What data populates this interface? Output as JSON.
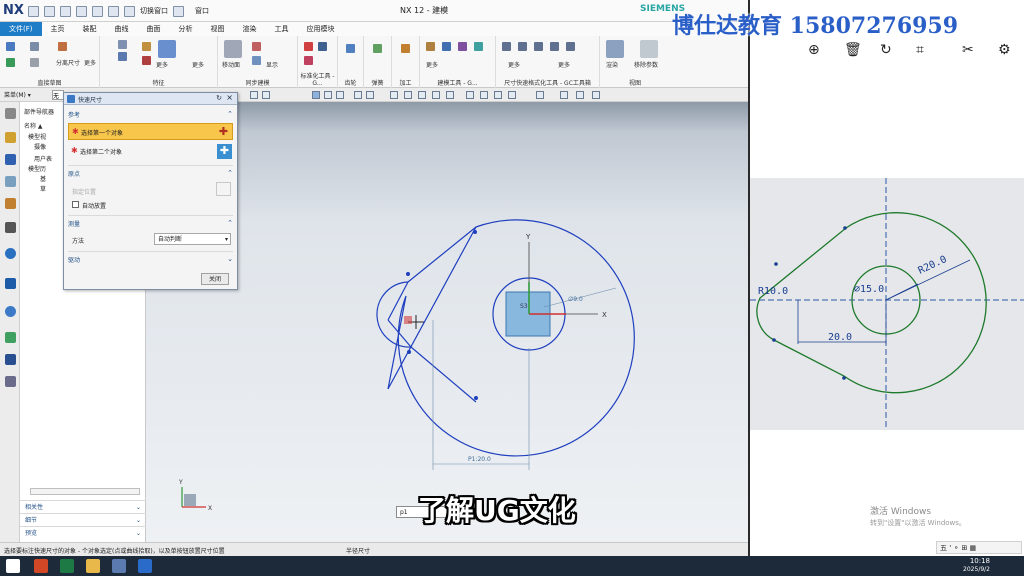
{
  "window": {
    "app_logo": "NX",
    "title": "NX 12 - 建模",
    "brand": "SIEMENS"
  },
  "quick_access": {
    "window_label": "窗口",
    "cut_label": "切换窗口"
  },
  "menu": {
    "items": [
      "文件(F)",
      "主页",
      "装配",
      "曲线",
      "曲面",
      "分析",
      "视图",
      "渲染",
      "工具",
      "应用模块"
    ]
  },
  "ribbon": {
    "groups": [
      "直接草图",
      "特征",
      "同步建模",
      "标准化工具 - G...",
      "齿轮",
      "弹簧",
      "加工",
      "建模工具 - G...",
      "尺寸快速格式化工具 - GC工具箱",
      "视图"
    ],
    "labels": [
      "分离尺寸",
      "更多",
      "更多",
      "更多",
      "移动面",
      "显示",
      "更多",
      "更多",
      "更多",
      "渲染",
      "移除参数",
      "更多",
      "更多",
      "更多",
      "更多",
      "更多",
      "更多"
    ]
  },
  "toolbar2": {
    "menu_label": "菜单(M) ▾",
    "filter_label": "无"
  },
  "nav": {
    "title": "部件导航器",
    "col_header": "名称 ▲",
    "tree": [
      "模型视",
      "摄像",
      "用户表",
      "模型历",
      "基",
      "草"
    ],
    "sections": [
      "相关性",
      "细节",
      "预览"
    ]
  },
  "dialog": {
    "title": "快速尺寸",
    "sec_ref": "参考",
    "sel_first": "选择第一个对象",
    "sel_second": "选择第二个对象",
    "sec_origin": "原点",
    "origin_loc": "指定位置",
    "auto_place": "自动放置",
    "sec_measure": "测量",
    "method_label": "方法",
    "method_value": "自动判断",
    "sec_driving": "驱动",
    "close_label": "关闭"
  },
  "viewport": {
    "dim_label": "P1:20.0",
    "dim_diam": "∅9.0",
    "small_label": "S3",
    "axis_x": "X",
    "axis_y": "Y",
    "axis_x_small": "X",
    "axis_y_small": "Y",
    "edit_value": "p1"
  },
  "status": {
    "left": "选择要标注快速尺寸的对象 - 个对象选定(点或曲线拾取)，以及单按钮放置尺寸位置",
    "mid": "半径尺寸"
  },
  "right_panel": {
    "dim_r20": "R20.0",
    "dim_r10": "R10.0",
    "dim_15": "∅15.0",
    "dim_20": "20.0",
    "activate_title": "激活 Windows",
    "activate_sub": "转到\"设置\"以激活 Windows。",
    "ime_text": "五 ' ⚬ ⊞ ▦"
  },
  "overlay": {
    "watermark": "博仕达教育 15807276959",
    "subtitle": "了解UG文化"
  },
  "taskbar": {
    "time": "10:18",
    "date": "2025/9/2"
  },
  "colors": {
    "accent": "#1f7dc8",
    "sketch_blue": "#1f3fbf",
    "sketch_green": "#1e7a2c",
    "selected_yellow": "#f8c64b"
  }
}
